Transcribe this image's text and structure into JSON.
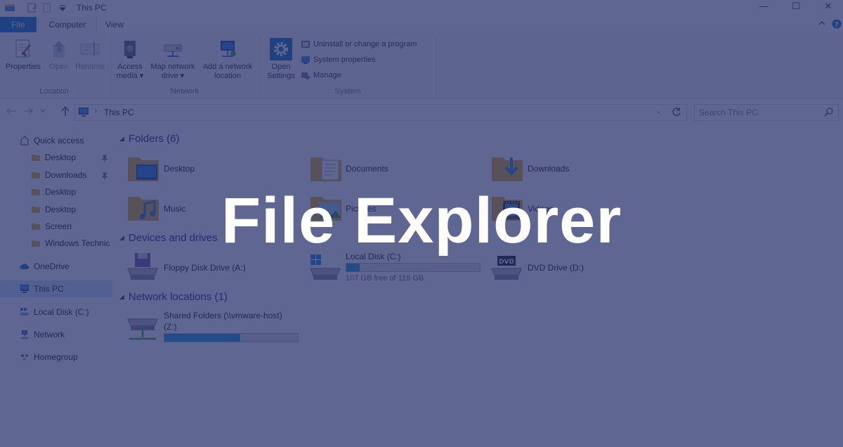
{
  "window": {
    "title": "This PC",
    "controls": [
      "minimize",
      "maximize",
      "close"
    ]
  },
  "ribbon": {
    "tabs": [
      {
        "label": "File",
        "kind": "file"
      },
      {
        "label": "Computer",
        "kind": "active"
      },
      {
        "label": "View",
        "kind": "normal"
      }
    ],
    "groups": {
      "location": {
        "label": "Location",
        "buttons": [
          {
            "label": "Properties",
            "icon": "properties-icon",
            "disabled": false
          },
          {
            "label": "Open",
            "icon": "open-icon",
            "disabled": true
          },
          {
            "label": "Rename",
            "icon": "rename-icon",
            "disabled": true
          }
        ]
      },
      "network": {
        "label": "Network",
        "buttons": [
          {
            "line1": "Access",
            "line2": "media ▾",
            "icon": "access-media-icon"
          },
          {
            "line1": "Map network",
            "line2": "drive ▾",
            "icon": "map-network-drive-icon"
          },
          {
            "line1": "Add a network",
            "line2": "location",
            "icon": "add-network-location-icon"
          }
        ]
      },
      "system": {
        "label": "System",
        "open_settings": {
          "line1": "Open",
          "line2": "Settings",
          "icon": "gear-icon"
        },
        "items": [
          {
            "label": "Uninstall or change a program",
            "icon": "uninstall-icon"
          },
          {
            "label": "System properties",
            "icon": "system-properties-icon"
          },
          {
            "label": "Manage",
            "icon": "manage-icon"
          }
        ]
      }
    }
  },
  "address": {
    "path": "This PC",
    "search_placeholder": "Search This PC"
  },
  "nav": {
    "items": [
      {
        "label": "Quick access",
        "icon": "star-icon",
        "indent": 0,
        "pinned": false
      },
      {
        "label": "Desktop",
        "icon": "folder-icon",
        "indent": 1,
        "pinned": true
      },
      {
        "label": "Downloads",
        "icon": "folder-icon",
        "indent": 1,
        "pinned": true
      },
      {
        "label": "Desktop",
        "icon": "folder-icon",
        "indent": 1,
        "pinned": false
      },
      {
        "label": "Desktop",
        "icon": "folder-icon",
        "indent": 1,
        "pinned": false
      },
      {
        "label": "Screen",
        "icon": "folder-icon",
        "indent": 1,
        "pinned": false
      },
      {
        "label": "Windows Technic",
        "icon": "folder-icon",
        "indent": 1,
        "pinned": false
      },
      {
        "label": "OneDrive",
        "icon": "cloud-icon",
        "indent": 0,
        "pinned": false
      },
      {
        "label": "This PC",
        "icon": "computer-icon",
        "indent": 0,
        "pinned": false,
        "selected": true
      },
      {
        "label": "Local Disk (C:)",
        "icon": "drive-icon",
        "indent": 0,
        "pinned": false
      },
      {
        "label": "Network",
        "icon": "network-icon",
        "indent": 0,
        "pinned": false
      },
      {
        "label": "Homegroup",
        "icon": "homegroup-icon",
        "indent": 0,
        "pinned": false
      }
    ]
  },
  "sections": {
    "folders": {
      "heading": "Folders (6)",
      "items": [
        {
          "label": "Desktop",
          "icon": "desktop-folder-icon"
        },
        {
          "label": "Documents",
          "icon": "documents-folder-icon"
        },
        {
          "label": "Downloads",
          "icon": "downloads-folder-icon"
        },
        {
          "label": "Music",
          "icon": "music-folder-icon"
        },
        {
          "label": "Pictures",
          "icon": "pictures-folder-icon"
        },
        {
          "label": "Videos",
          "icon": "videos-folder-icon"
        }
      ]
    },
    "devices": {
      "heading": "Devices and drives",
      "items": [
        {
          "label": "Floppy Disk Drive (A:)",
          "icon": "floppy-drive-icon"
        },
        {
          "label": "Local Disk (C:)",
          "icon": "local-disk-icon",
          "free": "107 GB free of 119 GB",
          "used_fraction": 0.1
        },
        {
          "label": "DVD Drive (D:)",
          "icon": "dvd-drive-icon"
        }
      ]
    },
    "network": {
      "heading": "Network locations (1)",
      "items": [
        {
          "label": "Shared Folders (\\\\vmware-host)",
          "label2": "(Z:)",
          "icon": "network-drive-icon",
          "used_fraction": 0.57
        }
      ]
    }
  },
  "overlay": {
    "title": "File Explorer"
  },
  "colors": {
    "accent": "#1979ca",
    "overlay": "#212b66",
    "bar_fill": "#26a0da",
    "folder": "#e8b43c"
  }
}
